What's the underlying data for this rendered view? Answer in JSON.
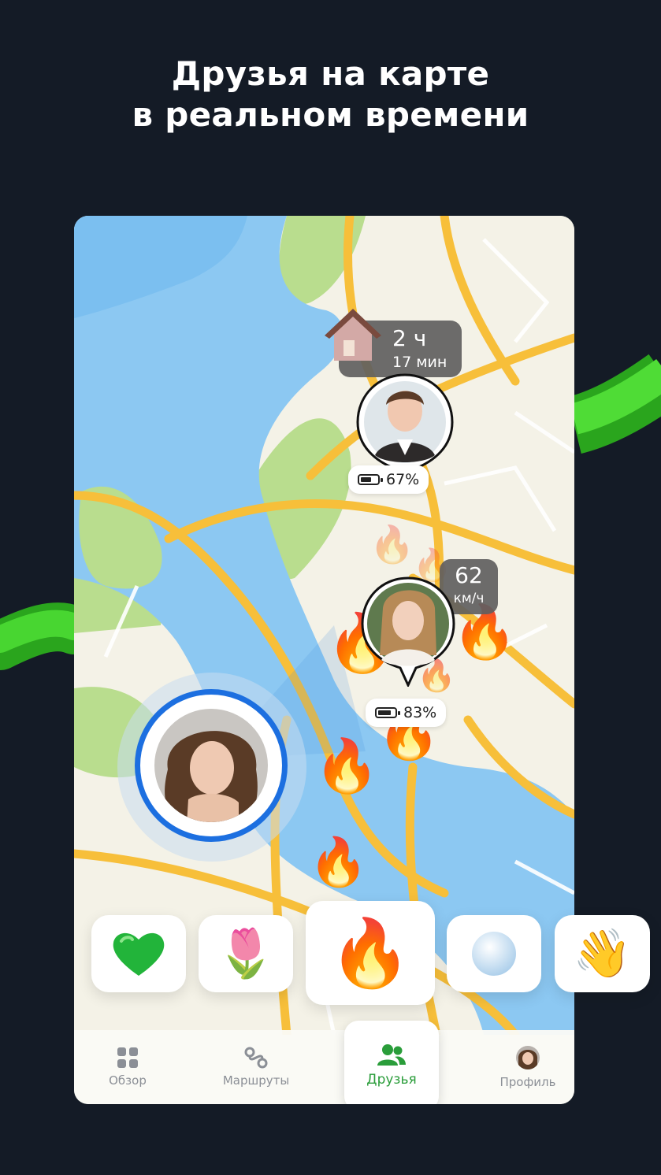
{
  "headline": {
    "line1": "Друзья на карте",
    "line2": "в реальном времени"
  },
  "colors": {
    "background": "#141b26",
    "accent_green": "#2a9d3a",
    "swoosh_green": "#3bd42a",
    "water": "#8cc8f2",
    "park": "#b9dd8e",
    "road": "#f7bf3a",
    "user_ring": "#1c6fe0"
  },
  "map": {
    "home_marker": {
      "icon": "house-icon",
      "duration_hours": "2 ч",
      "duration_minutes": "17 мин"
    },
    "friend_1": {
      "battery": "67%",
      "battery_level": 0.67
    },
    "friend_2": {
      "speed_value": "62",
      "speed_unit": "км/ч",
      "battery": "83%",
      "battery_level": 0.83
    },
    "me": {
      "avatar": "user-avatar"
    }
  },
  "reactions": [
    {
      "name": "green-heart",
      "icon": "green-heart-icon"
    },
    {
      "name": "tulip",
      "icon": "tulip-icon"
    },
    {
      "name": "fire",
      "icon": "fire-icon",
      "selected": true
    },
    {
      "name": "snowball",
      "icon": "snowball-icon"
    },
    {
      "name": "wave",
      "icon": "waving-hand-icon"
    }
  ],
  "tabbar": {
    "overview": {
      "label": "Обзор",
      "icon": "grid-icon"
    },
    "routes": {
      "label": "Маршруты",
      "icon": "route-icon"
    },
    "friends": {
      "label": "Друзья",
      "icon": "people-icon",
      "active": true
    },
    "profile": {
      "label": "Профиль",
      "icon": "profile-avatar-icon"
    }
  }
}
